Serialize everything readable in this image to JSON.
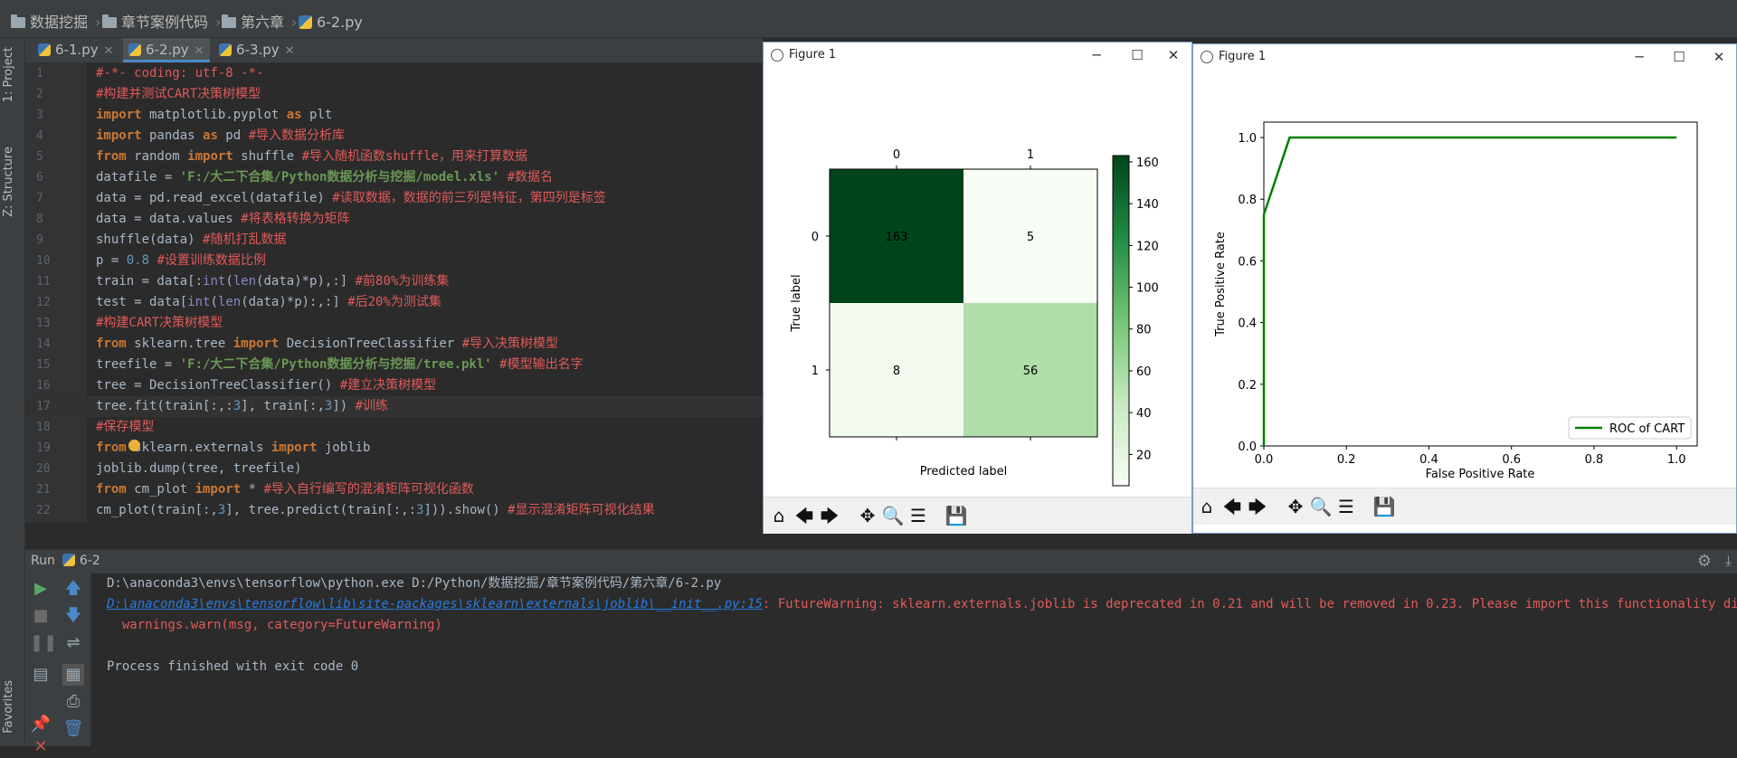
{
  "breadcrumb": [
    "数据挖掘",
    "章节案例代码",
    "第六章",
    "6-2.py"
  ],
  "left_toolwindows": [
    "1: Project",
    "Z: Structure",
    "Favorites"
  ],
  "tabs": [
    {
      "label": "6-1.py",
      "active": false
    },
    {
      "label": "6-2.py",
      "active": true
    },
    {
      "label": "6-3.py",
      "active": false
    }
  ],
  "editor": {
    "current_line": 17,
    "lines": [
      {
        "n": "1"
      },
      {
        "n": "2"
      },
      {
        "n": "3"
      },
      {
        "n": "4"
      },
      {
        "n": "5"
      },
      {
        "n": "6"
      },
      {
        "n": "7"
      },
      {
        "n": "8"
      },
      {
        "n": "9"
      },
      {
        "n": "10"
      },
      {
        "n": "11"
      },
      {
        "n": "12"
      },
      {
        "n": "13"
      },
      {
        "n": "14"
      },
      {
        "n": "15"
      },
      {
        "n": "16"
      },
      {
        "n": "17"
      },
      {
        "n": "18"
      },
      {
        "n": "19"
      },
      {
        "n": "20"
      },
      {
        "n": "21"
      },
      {
        "n": "22"
      }
    ],
    "code": {
      "l1": "#-*- coding: utf-8 -*-",
      "l2": "#构建并测试CART决策树模型",
      "l3a": "import",
      "l3b": " matplotlib.pyplot ",
      "l3c": "as",
      "l3d": " plt",
      "l4a": "import",
      "l4b": " pandas ",
      "l4c": "as",
      "l4d": " pd ",
      "l4e": "#导入数据分析库",
      "l5a": "from",
      "l5b": " random ",
      "l5c": "import",
      "l5d": " shuffle ",
      "l5e": "#导入随机函数shuffle，用来打算数据",
      "l6a": "datafile = ",
      "l6b": "'F:/大二下合集/Python数据分析与挖掘/model.xls'",
      "l6c": " ",
      "l6d": "#数据名",
      "l7a": "data = pd.read_excel(datafile) ",
      "l7b": "#读取数据，数据的前三列是特征，第四列是标签",
      "l8a": "data = data.values ",
      "l8b": "#将表格转换为矩阵",
      "l9a": "shuffle(data) ",
      "l9b": "#随机打乱数据",
      "l10a": "p = ",
      "l10b": "0.8",
      "l10c": " ",
      "l10d": "#设置训练数据比例",
      "l11a": "train = data[:",
      "l11b": "int",
      "l11c": "(",
      "l11d": "len",
      "l11e": "(data)*p),:] ",
      "l11f": "#前80%为训练集",
      "l12a": "test = data[",
      "l12b": "int",
      "l12c": "(",
      "l12d": "len",
      "l12e": "(data)*p):,:] ",
      "l12f": "#后20%为测试集",
      "l13": "#构建CART决策树模型",
      "l14a": "from",
      "l14b": " sklearn.tree ",
      "l14c": "import",
      "l14d": " DecisionTreeClassifier ",
      "l14e": "#导入决策树模型",
      "l15a": "treefile = ",
      "l15b": "'F:/大二下合集/Python数据分析与挖掘/tree.pkl'",
      "l15c": " ",
      "l15d": "#模型输出名字",
      "l16a": "tree = DecisionTreeClassifier() ",
      "l16b": "#建立决策树模型",
      "l17a": "tree.fit(train[:,:",
      "l17b": "3",
      "l17c": "], train[:,",
      "l17d": "3",
      "l17e": "]) ",
      "l17f": "#训练",
      "l18": "#保存模型",
      "l19a": "from",
      "l19b": " sklearn.externals ",
      "l19c": "import",
      "l19d": " joblib",
      "l20": "joblib.dump(tree, treefile)",
      "l21a": "from",
      "l21b": " cm_plot ",
      "l21c": "import",
      "l21d": " * ",
      "l21e": "#导入自行编写的混淆矩阵可视化函数",
      "l22a": "cm_plot(train[:,",
      "l22b": "3",
      "l22c": "], tree.predict(train[:,:",
      "l22d": "3",
      "l22e": "])).show() ",
      "l22f": "#显示混淆矩阵可视化结果"
    }
  },
  "run": {
    "label": "Run",
    "config": "6-2",
    "console": [
      {
        "text": "D:\\anaconda3\\envs\\tensorflow\\python.exe D:/Python/数据挖掘/章节案例代码/第六章/6-2.py",
        "kind": "normal"
      },
      {
        "link": "D:\\anaconda3\\envs\\tensorflow\\lib\\site-packages\\sklearn\\externals\\joblib\\__init__.py:15",
        "text": ": FutureWarning: sklearn.externals.joblib is deprecated in 0.21 and will be removed in 0.23. Please import this functionality directly f",
        "kind": "warning"
      },
      {
        "text": "  warnings.warn(msg, category=FutureWarning)",
        "kind": "error"
      },
      {
        "text": "",
        "kind": "normal"
      },
      {
        "text": "Process finished with exit code 0",
        "kind": "normal"
      }
    ]
  },
  "figures": [
    {
      "title": "Figure 1"
    },
    {
      "title": "Figure 1"
    }
  ],
  "chart_data": [
    {
      "type": "heatmap",
      "matrix": [
        [
          163,
          5
        ],
        [
          8,
          56
        ]
      ],
      "row_labels": [
        "0",
        "1"
      ],
      "col_labels": [
        "0",
        "1"
      ],
      "xlabel": "Predicted label",
      "ylabel": "True label",
      "colormap": "Greens",
      "colorbar_ticks": [
        20,
        40,
        60,
        80,
        100,
        120,
        140,
        160
      ],
      "colorbar_range": [
        5,
        163
      ]
    },
    {
      "type": "line",
      "series": [
        {
          "name": "ROC of CART",
          "color": "#008000",
          "x": [
            0.0,
            0.0,
            0.0625,
            1.0
          ],
          "y": [
            0.0,
            0.75,
            1.0,
            1.0
          ]
        }
      ],
      "xlabel": "False Positive Rate",
      "ylabel": "True Positive Rate",
      "xlim": [
        0.0,
        1.05
      ],
      "ylim": [
        0.0,
        1.05
      ],
      "xticks": [
        "0.0",
        "0.2",
        "0.4",
        "0.6",
        "0.8",
        "1.0"
      ],
      "yticks": [
        "0.0",
        "0.2",
        "0.4",
        "0.6",
        "0.8",
        "1.0"
      ],
      "legend": "lower-right",
      "grid": false
    }
  ],
  "colors": {
    "accent": "#4a88c7",
    "warning_text": "#e05a5a",
    "link": "#287bde"
  }
}
